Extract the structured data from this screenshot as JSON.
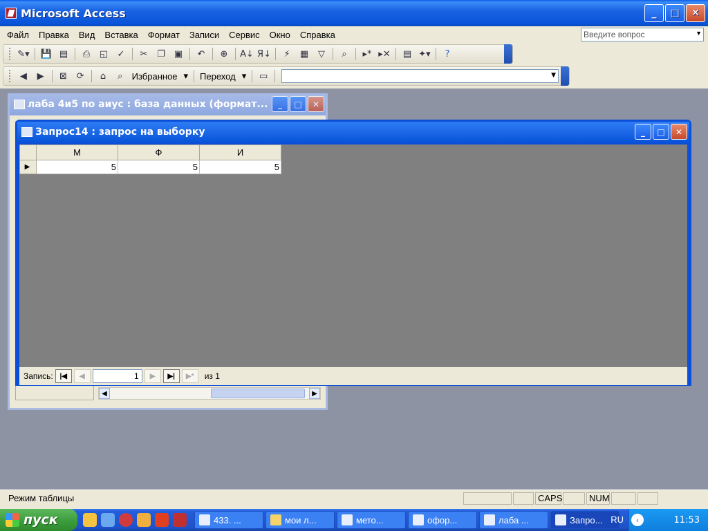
{
  "app": {
    "title": "Microsoft Access"
  },
  "menu": {
    "items": [
      "Файл",
      "Правка",
      "Вид",
      "Вставка",
      "Формат",
      "Записи",
      "Сервис",
      "Окно",
      "Справка"
    ],
    "help_placeholder": "Введите вопрос"
  },
  "web_toolbar": {
    "favorites": "Избранное",
    "goto": "Переход"
  },
  "db_window": {
    "title": "лаба 4и5 по аиус : база данных (формат..."
  },
  "query_window": {
    "title": "Запрос14 : запрос на выборку",
    "columns": [
      "М",
      "Ф",
      "И"
    ],
    "rows": [
      [
        "5",
        "5",
        "5"
      ]
    ],
    "nav": {
      "label": "Запись:",
      "current": "1",
      "of_label": "из 1"
    }
  },
  "status": {
    "mode": "Режим таблицы",
    "caps": "CAPS",
    "num": "NUM"
  },
  "taskbar": {
    "start": "пуск",
    "tasks": [
      "433. ...",
      "мои л...",
      "мето...",
      "офор...",
      "лаба ...",
      "Запро..."
    ],
    "lang": "RU",
    "clock": "11:53"
  },
  "colors": {
    "titlebar": "#0854d9",
    "workspace": "#8e93a4"
  }
}
